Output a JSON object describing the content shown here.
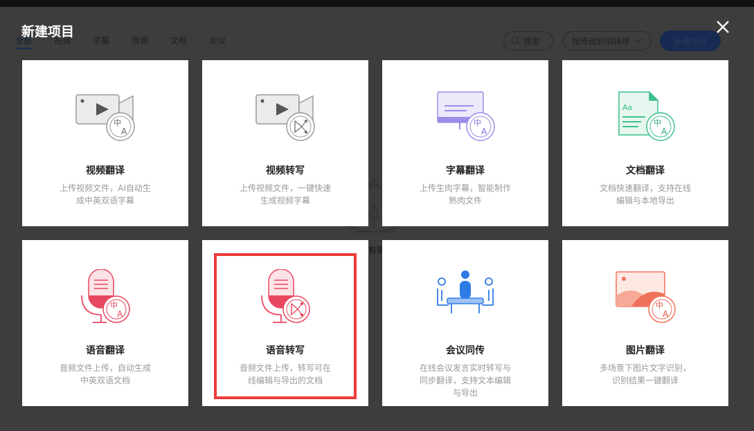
{
  "modal": {
    "title": "新建项目"
  },
  "background": {
    "tabs": [
      "全部",
      "视频",
      "字幕",
      "音频",
      "文档",
      "会议"
    ],
    "search_label": "搜索",
    "sort_label": "按修改时间排序",
    "new_button": "新建项目",
    "logo_text": "有限"
  },
  "cards": [
    {
      "title": "视频翻译",
      "desc": "上传视频文件，AI自动生成中英双语字幕",
      "icon": "video-translate-icon"
    },
    {
      "title": "视频转写",
      "desc": "上传视频文件，一键快速生成视频字幕",
      "icon": "video-transcribe-icon"
    },
    {
      "title": "字幕翻译",
      "desc": "上传生肉字幕，智能制作熟肉文件",
      "icon": "subtitle-translate-icon"
    },
    {
      "title": "文档翻译",
      "desc": "文档快速翻译，支持在线编辑与本地导出",
      "icon": "document-translate-icon"
    },
    {
      "title": "语音翻译",
      "desc": "音频文件上传，自动生成中英双语文档",
      "icon": "audio-translate-icon"
    },
    {
      "title": "语音转写",
      "desc": "音频文件上传，转写可在线编辑与导出的文档",
      "icon": "audio-transcribe-icon"
    },
    {
      "title": "会议同传",
      "desc": "在线会议发言实时转写与同步翻译，支持文本编辑与导出",
      "icon": "meeting-interpret-icon"
    },
    {
      "title": "图片翻译",
      "desc": "多场景下图片文字识别，识别结果一键翻译",
      "icon": "image-translate-icon"
    }
  ],
  "badge_text": {
    "zh": "中",
    "en": "A",
    "aa": "Aa"
  },
  "colors": {
    "gray": "#999999",
    "purple": "#9b8de8",
    "green": "#3cbf8a",
    "red": "#e8475f",
    "blue": "#2f7be5",
    "coral": "#f0715a",
    "highlight": "#ef3a3a"
  }
}
